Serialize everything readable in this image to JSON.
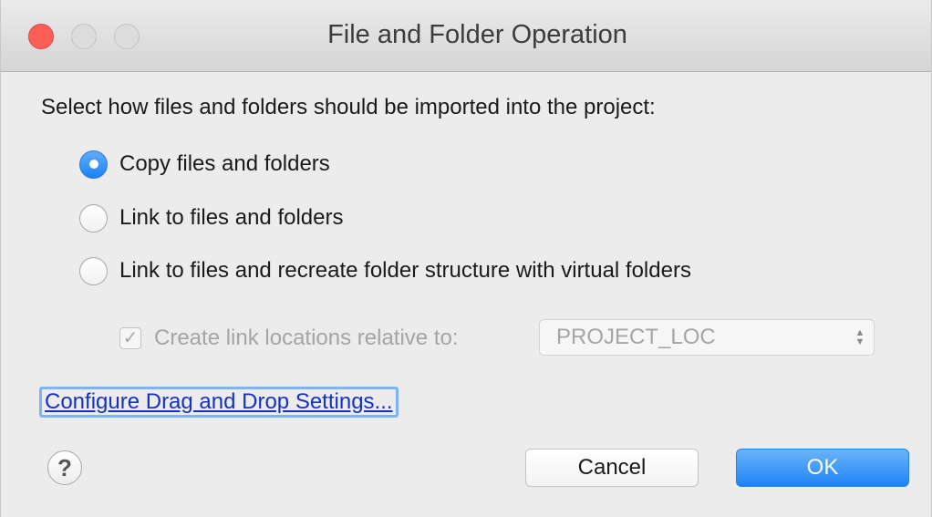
{
  "window": {
    "title": "File and Folder Operation"
  },
  "prompt": "Select how files and folders should be imported into the project:",
  "options": [
    {
      "label": "Copy files and folders",
      "selected": true
    },
    {
      "label": "Link to files and folders",
      "selected": false
    },
    {
      "label": "Link to files and recreate folder structure with virtual folders",
      "selected": false
    }
  ],
  "link_locations": {
    "checkbox_checked": true,
    "enabled": false,
    "label": "Create link locations relative to:",
    "select_value": "PROJECT_LOC"
  },
  "config_link": "Configure Drag and Drop Settings...",
  "help_symbol": "?",
  "buttons": {
    "cancel": "Cancel",
    "ok": "OK"
  },
  "colors": {
    "accent": "#1a82f5",
    "close": "#fc5f57",
    "link": "#1432c8"
  }
}
